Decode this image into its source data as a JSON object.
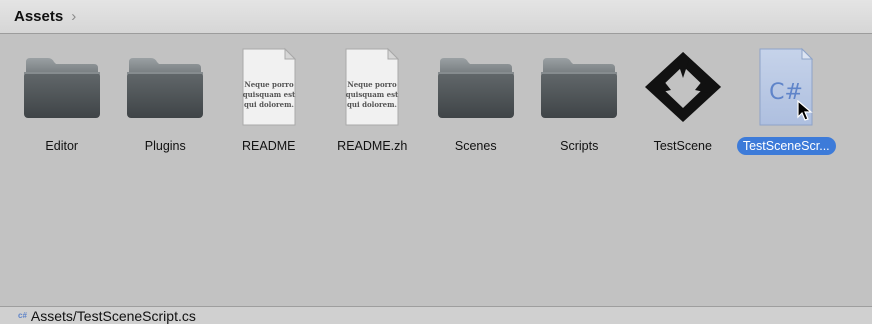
{
  "breadcrumb": {
    "root": "Assets",
    "separator": "›"
  },
  "assets": [
    {
      "label": "Editor",
      "kind": "folder-icon"
    },
    {
      "label": "Plugins",
      "kind": "folder-icon"
    },
    {
      "label": "README",
      "kind": "text-document-icon",
      "preview": [
        "Neque porro",
        "quisquam est",
        "qui dolorem."
      ]
    },
    {
      "label": "README.zh",
      "kind": "text-document-icon",
      "preview": [
        "Neque porro",
        "quisquam est",
        "qui dolorem."
      ]
    },
    {
      "label": "Scenes",
      "kind": "folder-icon"
    },
    {
      "label": "Scripts",
      "kind": "folder-icon"
    },
    {
      "label": "TestScene",
      "kind": "unity-scene-icon"
    },
    {
      "label": "TestSceneScr...",
      "kind": "csharp-script-icon",
      "glyph": "C#",
      "selected": true
    }
  ],
  "status": {
    "icon": "c#",
    "path": "Assets/TestSceneScript.cs"
  },
  "colors": {
    "selection": "#3d7bd9",
    "csharp": "#5f84c9",
    "folder": "#4f5558"
  }
}
